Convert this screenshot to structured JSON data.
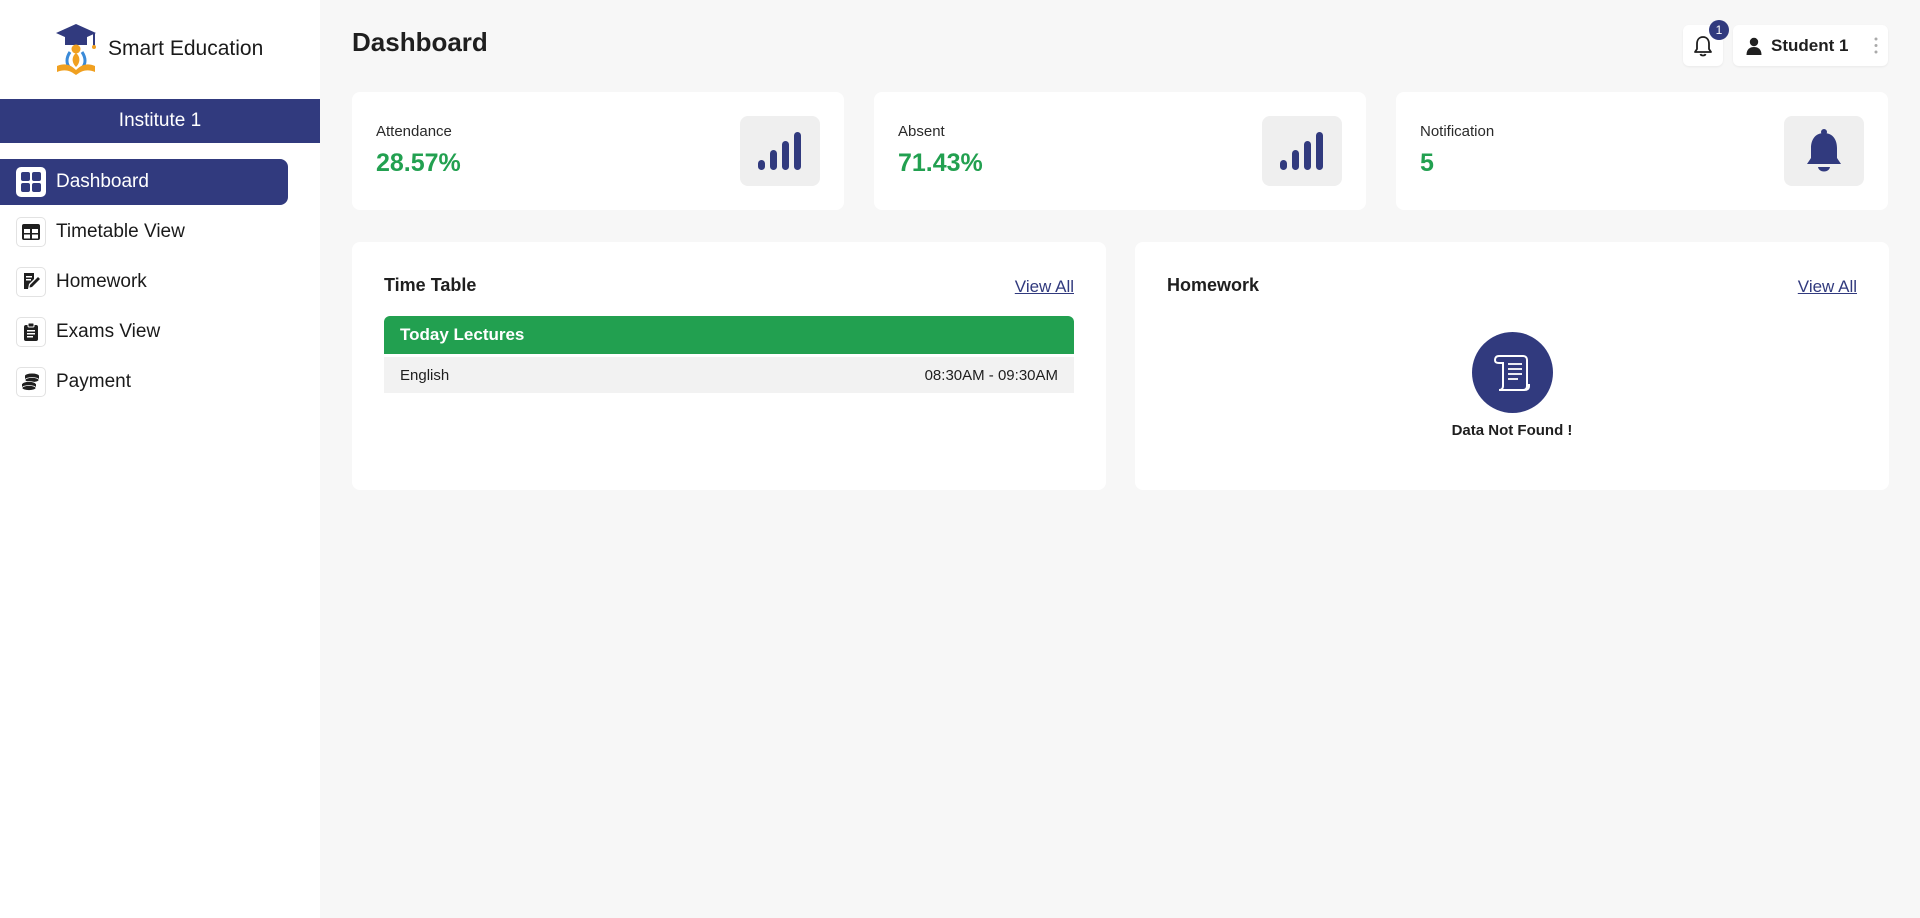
{
  "app": {
    "brand": "Smart Education",
    "institute": "Institute 1"
  },
  "sidebar": {
    "items": [
      {
        "label": "Dashboard",
        "icon": "dashboard-grid-icon",
        "active": true
      },
      {
        "label": "Timetable View",
        "icon": "table-icon",
        "active": false
      },
      {
        "label": "Homework",
        "icon": "edit-document-icon",
        "active": false
      },
      {
        "label": "Exams View",
        "icon": "clipboard-icon",
        "active": false
      },
      {
        "label": "Payment",
        "icon": "coins-icon",
        "active": false
      }
    ]
  },
  "header": {
    "title": "Dashboard",
    "notification_count": "1",
    "user_name": "Student 1"
  },
  "stats": [
    {
      "label": "Attendance",
      "value": "28.57%",
      "icon": "signal-bars-icon"
    },
    {
      "label": "Absent",
      "value": "71.43%",
      "icon": "signal-bars-icon"
    },
    {
      "label": "Notification",
      "value": "5",
      "icon": "bell-icon"
    }
  ],
  "timetable": {
    "title": "Time Table",
    "view_all": "View All",
    "section_title": "Today Lectures",
    "lectures": [
      {
        "subject": "English",
        "time": "08:30AM - 09:30AM"
      }
    ]
  },
  "homework": {
    "title": "Homework",
    "view_all": "View All",
    "empty_text": "Data Not Found !",
    "icon": "scroll-document-icon"
  },
  "colors": {
    "primary": "#313a7e",
    "success": "#22a050",
    "background": "#f7f7f7",
    "card": "#ffffff"
  }
}
